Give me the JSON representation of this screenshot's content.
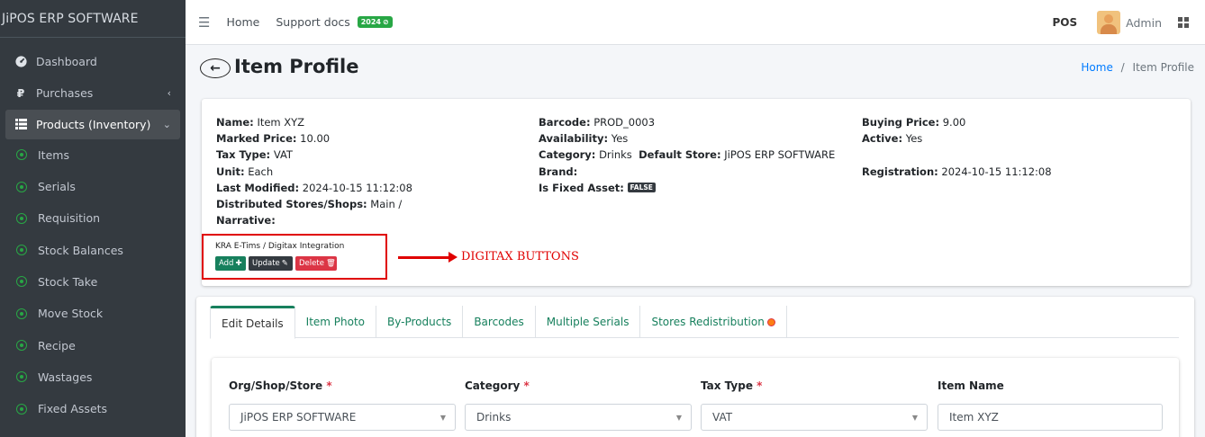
{
  "sidebar": {
    "brand": "JiPOS ERP SOFTWARE",
    "items": [
      {
        "label": "Dashboard",
        "icon": "tachometer-icon"
      },
      {
        "label": "Purchases",
        "icon": "ruble-icon"
      },
      {
        "label": "Products (Inventory)",
        "icon": "list-icon"
      },
      {
        "label": "Items"
      },
      {
        "label": "Serials"
      },
      {
        "label": "Requisition"
      },
      {
        "label": "Stock Balances"
      },
      {
        "label": "Stock Take"
      },
      {
        "label": "Move Stock"
      },
      {
        "label": "Recipe"
      },
      {
        "label": "Wastages"
      },
      {
        "label": "Fixed Assets"
      }
    ]
  },
  "navbar": {
    "home": "Home",
    "support": "Support docs",
    "year_badge": "2024",
    "pos": "POS",
    "user": "Admin"
  },
  "header": {
    "title": "Item Profile",
    "breadcrumb_home": "Home",
    "breadcrumb_sep": "/",
    "breadcrumb_current": "Item Profile"
  },
  "profile": {
    "name_label": "Name:",
    "name": "Item XYZ",
    "marked_label": "Marked Price:",
    "marked": "10.00",
    "tax_label": "Tax Type:",
    "tax": "VAT",
    "unit_label": "Unit:",
    "unit": "Each",
    "modified_label": "Last Modified:",
    "modified": "2024-10-15 11:12:08",
    "distributed_label": "Distributed Stores/Shops:",
    "distributed": "Main /",
    "narrative_label": "Narrative:",
    "barcode_label": "Barcode:",
    "barcode": "PROD_0003",
    "availability_label": "Availability:",
    "availability": "Yes",
    "category_label": "Category:",
    "category": "Drinks",
    "default_store_label": "Default Store:",
    "default_store": "JiPOS ERP SOFTWARE",
    "brand_label": "Brand:",
    "fixed_asset_label": "Is Fixed Asset:",
    "fixed_asset": "FALSE",
    "buying_label": "Buying Price:",
    "buying": "9.00",
    "active_label": "Active:",
    "active": "Yes",
    "registration_label": "Registration:",
    "registration": "2024-10-15 11:12:08"
  },
  "digitax": {
    "title": "KRA E-Tims / Digitax Integration",
    "add": "Add",
    "update": "Update",
    "delete": "Delete",
    "annotation": "DIGITAX BUTTONS"
  },
  "tabs": [
    "Edit Details",
    "Item Photo",
    "By-Products",
    "Barcodes",
    "Multiple Serials",
    "Stores Redistribution"
  ],
  "form": {
    "org_label": "Org/Shop/Store",
    "org_value": "JiPOS ERP SOFTWARE",
    "category_label": "Category",
    "category_value": "Drinks",
    "tax_label": "Tax Type",
    "tax_value": "VAT",
    "name_label": "Item Name",
    "name_value": "Item XYZ",
    "required_mark": "*"
  }
}
